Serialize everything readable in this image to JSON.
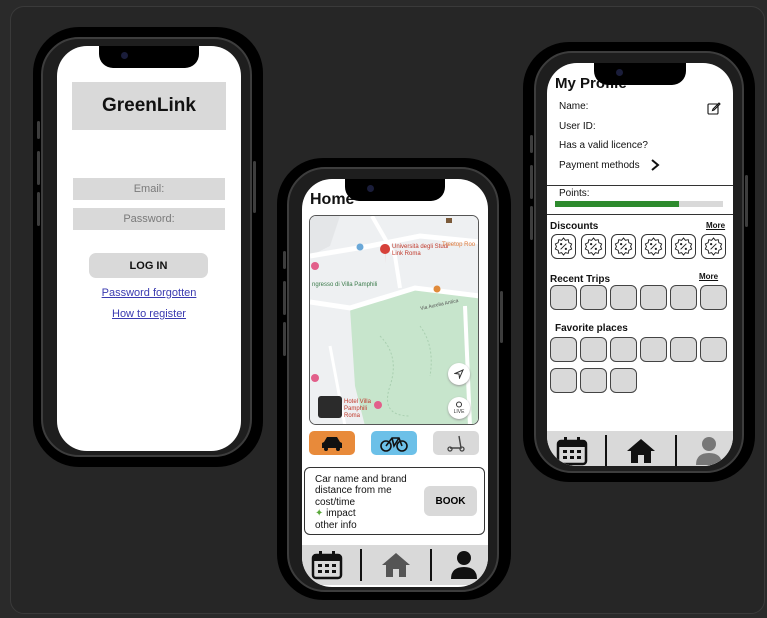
{
  "login": {
    "app_name": "GreenLink",
    "email_placeholder": "Email:",
    "password_placeholder": "Password:",
    "login_label": "LOG IN",
    "forgot_link": "Password forgotten",
    "register_link": "How to register"
  },
  "home": {
    "title": "Home",
    "map": {
      "poi_university": "Università degli Studi Link Roma",
      "poi_treetop": "Treetop Roo",
      "poi_villa": "ngresso di Villa Pamphili",
      "poi_hotel": "Hotel Villa Pamphili Roma",
      "road_aurelia": "Via Aurelia Antica",
      "live_label": "LIVE"
    },
    "vehicles": [
      {
        "name": "car",
        "color": "#e88a3a"
      },
      {
        "name": "bike",
        "color": "#6cc0e8"
      },
      {
        "name": "scooter",
        "color": "#d9d9d9"
      }
    ],
    "card": {
      "line1": "Car name and brand",
      "line2": "distance from me",
      "line3": "cost/time",
      "line4": "impact",
      "line5": "other info",
      "book_label": "BOOK"
    }
  },
  "profile": {
    "title": "My Profile",
    "name_label": "Name:",
    "user_id_label": "User ID:",
    "licence_label": "Has a valid licence?",
    "payment_label": "Payment methods",
    "points_label": "Points:",
    "points_progress": 0.74,
    "discounts_label": "Discounts",
    "discounts_more": "More",
    "recent_label": "Recent Trips",
    "recent_more": "More",
    "favorites_label": "Favorite places"
  },
  "colors": {
    "progress_fill": "#2e8b2e",
    "accent_car": "#e88a3a",
    "accent_bike": "#6cc0e8"
  }
}
